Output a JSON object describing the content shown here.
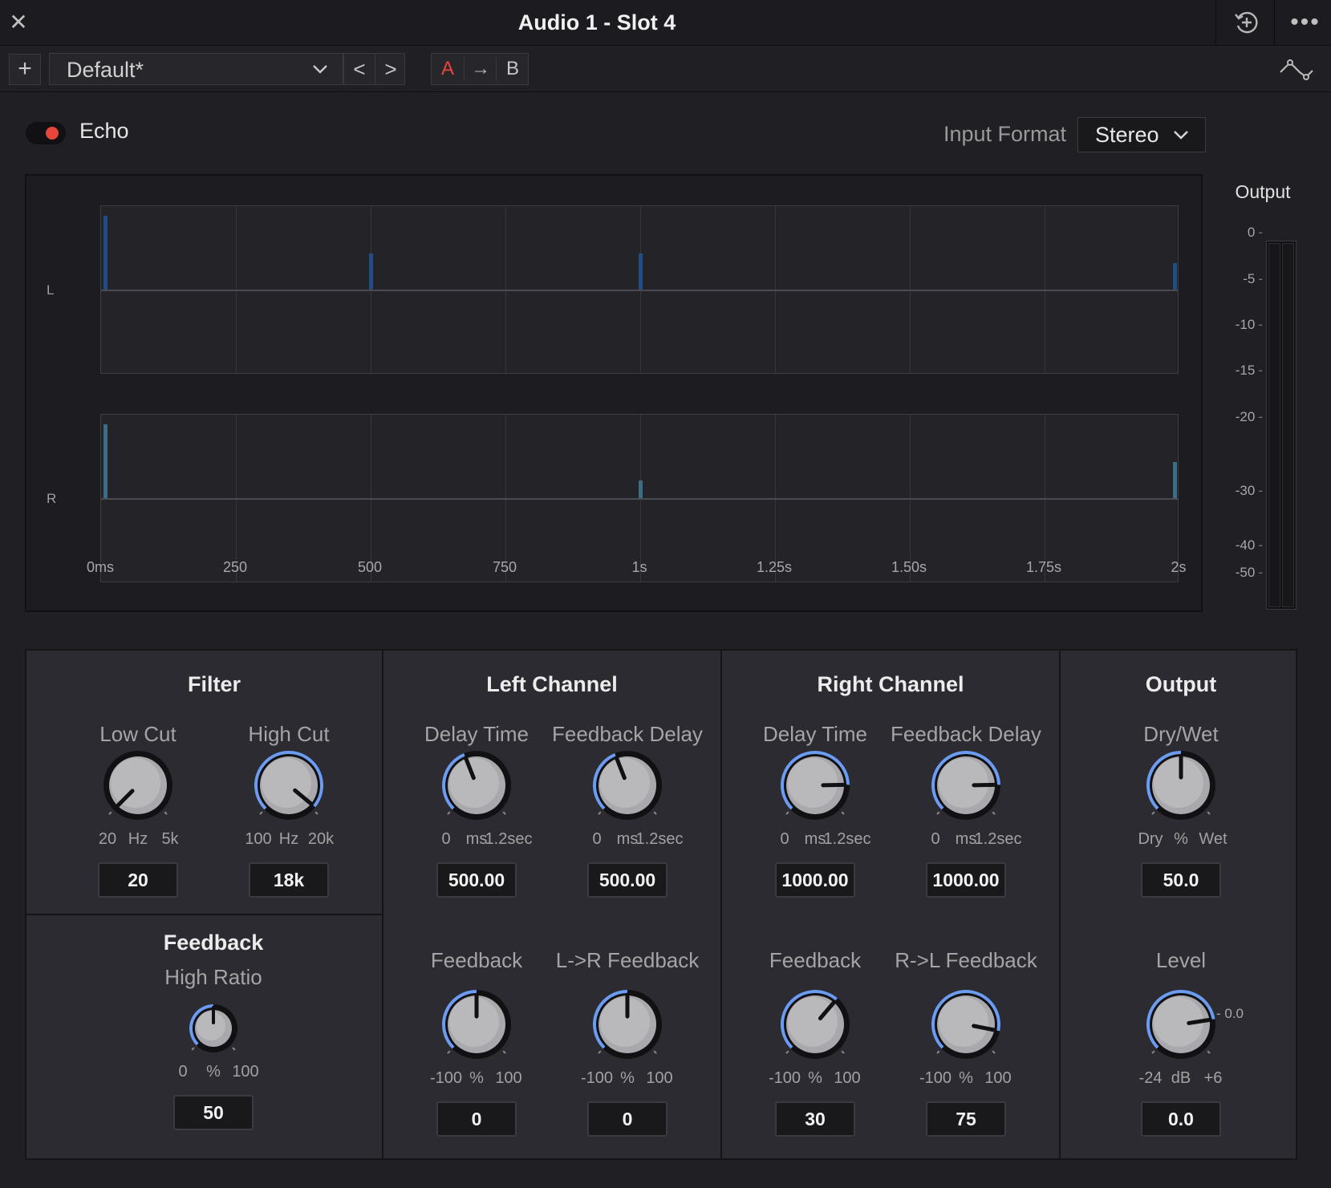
{
  "window": {
    "title": "Audio 1 - Slot 4",
    "close_glyph": "✕",
    "more_glyph": "•••",
    "icons": [
      "close-icon",
      "history-add-icon",
      "more-icon",
      "chevron-down-icon",
      "curve-icon"
    ]
  },
  "preset_bar": {
    "add_glyph": "+",
    "preset_name": "Default*",
    "prev_glyph": "<",
    "next_glyph": ">",
    "compare_a": "A",
    "compare_arrow": "→",
    "compare_b": "B"
  },
  "plugin": {
    "name": "Echo",
    "enabled": true,
    "input_format_label": "Input Format",
    "input_format_value": "Stereo"
  },
  "display": {
    "left_label": "L",
    "right_label": "R",
    "time_ticks": [
      "0ms",
      "250",
      "500",
      "750",
      "1s",
      "1.25s",
      "1.50s",
      "1.75s",
      "2s"
    ],
    "tap_fractions": [
      0.0,
      0.25,
      0.5,
      0.75,
      1.0
    ],
    "left_taps": [
      {
        "time_frac": 0.0,
        "level": 0.92
      },
      {
        "time_frac": 0.25,
        "level": 0.45
      },
      {
        "time_frac": 0.5,
        "level": 0.45
      },
      {
        "time_frac": 1.0,
        "level": 0.33
      }
    ],
    "right_taps": [
      {
        "time_frac": 0.0,
        "level": 0.92
      },
      {
        "time_frac": 0.5,
        "level": 0.22
      },
      {
        "time_frac": 1.0,
        "level": 0.45
      }
    ],
    "left_color": "#1f4e86",
    "right_color": "#3a6d86"
  },
  "meter": {
    "title": "Output",
    "ticks": [
      "0",
      "-5",
      "-10",
      "-15",
      "-20",
      "-30",
      "-40",
      "-50"
    ]
  },
  "sections": {
    "filter": {
      "title": "Filter",
      "low_cut": {
        "label": "Low Cut",
        "min": "20",
        "unit": "Hz",
        "max": "5k",
        "value": "20",
        "position": 0.0
      },
      "high_cut": {
        "label": "High Cut",
        "min": "100",
        "unit": "Hz",
        "max": "20k",
        "value": "18k",
        "position": 0.98
      }
    },
    "feedback": {
      "title": "Feedback",
      "high_ratio": {
        "label": "High Ratio",
        "min": "0",
        "unit": "%",
        "max": "100",
        "value": "50",
        "position": 0.5
      }
    },
    "left_channel": {
      "title": "Left Channel",
      "delay_time": {
        "label": "Delay Time",
        "min": "0",
        "unit": "ms",
        "max": "1.2sec",
        "value": "500.00",
        "position": 0.42
      },
      "feedback_delay": {
        "label": "Feedback Delay",
        "min": "0",
        "unit": "ms",
        "max": "1.2sec",
        "value": "500.00",
        "position": 0.42
      },
      "feedback": {
        "label": "Feedback",
        "min": "-100",
        "unit": "%",
        "max": "100",
        "value": "0",
        "position": 0.5
      },
      "cross_feedback": {
        "label": "L->R Feedback",
        "min": "-100",
        "unit": "%",
        "max": "100",
        "value": "0",
        "position": 0.5
      }
    },
    "right_channel": {
      "title": "Right Channel",
      "delay_time": {
        "label": "Delay Time",
        "min": "0",
        "unit": "ms",
        "max": "1.2sec",
        "value": "1000.00",
        "position": 0.83
      },
      "feedback_delay": {
        "label": "Feedback Delay",
        "min": "0",
        "unit": "ms",
        "max": "1.2sec",
        "value": "1000.00",
        "position": 0.83
      },
      "feedback": {
        "label": "Feedback",
        "min": "-100",
        "unit": "%",
        "max": "100",
        "value": "30",
        "position": 0.65
      },
      "cross_feedback": {
        "label": "R->L Feedback",
        "min": "-100",
        "unit": "%",
        "max": "100",
        "value": "75",
        "position": 0.875
      }
    },
    "output": {
      "title": "Output",
      "dry_wet": {
        "label": "Dry/Wet",
        "min": "Dry",
        "unit": "%",
        "max": "Wet",
        "value": "50.0",
        "position": 0.5
      },
      "level": {
        "label": "Level",
        "min": "-24",
        "unit": "dB",
        "max": "+6",
        "value": "0.0",
        "position": 0.8,
        "unity_mark": "- 0.0"
      }
    }
  },
  "colors": {
    "accent": "#6b9cf2",
    "record_red": "#e8463b",
    "compare_a": "#e8463b",
    "background": "#1f1f24",
    "panel": "#2b2b31"
  }
}
